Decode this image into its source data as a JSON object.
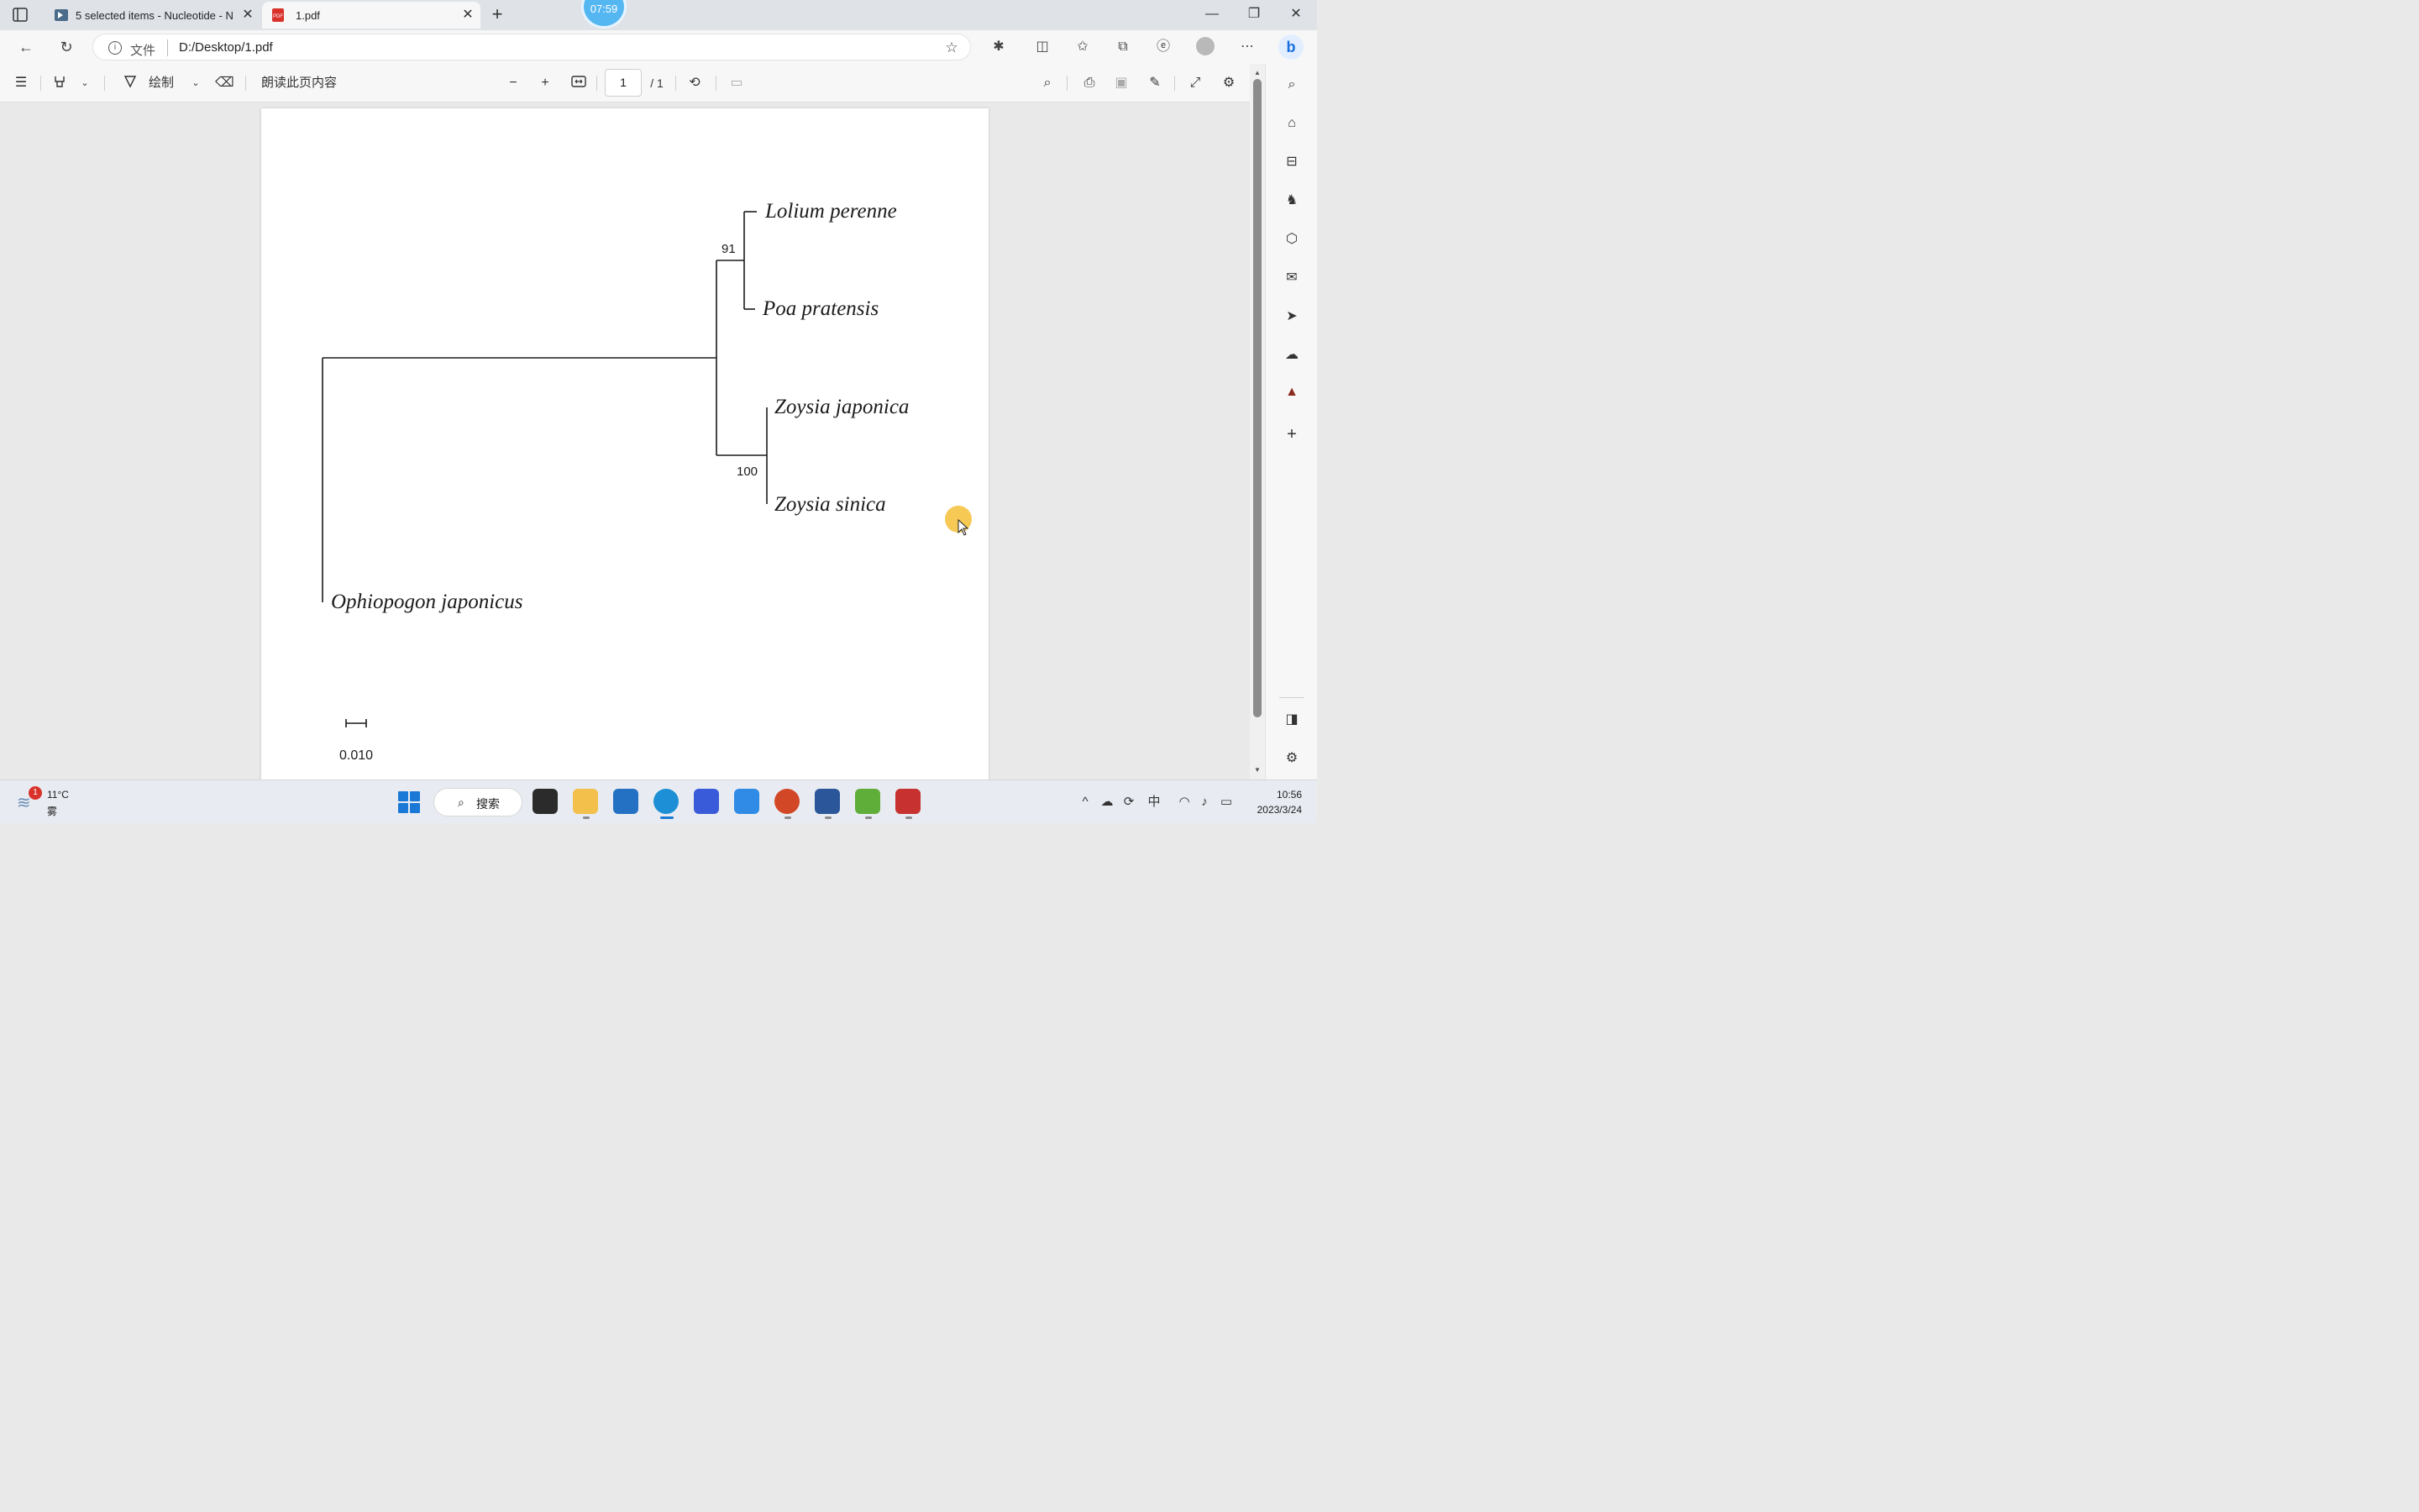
{
  "browser": {
    "tabs": [
      {
        "label": "5 selected items - Nucleotide - N",
        "active": false
      },
      {
        "label": "1.pdf",
        "active": true
      }
    ],
    "timer": "07:59",
    "address": {
      "protocol_label": "文件",
      "url": "D:/Desktop/1.pdf"
    }
  },
  "pdf_toolbar": {
    "draw_label": "绘制",
    "read_aloud_label": "朗读此页内容",
    "page_current": "1",
    "page_total": "/ 1"
  },
  "tree": {
    "taxa": [
      "Lolium perenne",
      "Poa pratensis",
      "Zoysia japonica",
      "Zoysia sinica",
      "Ophiopogon japonicus"
    ],
    "bootstrap": {
      "lolium_poa": "91",
      "zoysia": "100"
    },
    "scale_label": "0.010"
  },
  "taskbar": {
    "weather_temp": "11°C",
    "weather_desc": "雾",
    "weather_badge": "1",
    "search_label": "搜索",
    "ime": "中",
    "time": "10:56",
    "date": "2023/3/24"
  },
  "colors": {
    "accent": "#1a78d6",
    "cursor_highlight": "#f5c342",
    "timer": "#55b7f2"
  }
}
